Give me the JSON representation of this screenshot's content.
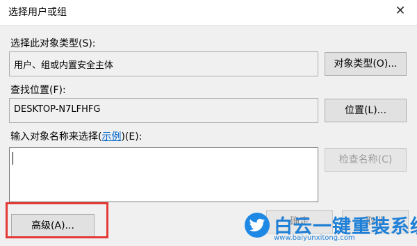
{
  "window": {
    "title": "选择用户或组"
  },
  "object_type": {
    "label": "选择此对象类型(S):",
    "value": "用户、组或内置安全主体",
    "button": "对象类型(O)..."
  },
  "location": {
    "label": "查找位置(F):",
    "value": "DESKTOP-N7LFHFG",
    "button": "位置(L)..."
  },
  "names": {
    "label_prefix": "输入对象名称来选择(",
    "label_link": "示例",
    "label_suffix": ")(E):",
    "value": "",
    "check_button": "检查名称(C)"
  },
  "footer": {
    "advanced_button": "高级(A)...",
    "ok_button": "确定",
    "cancel_button": "取消"
  },
  "watermark": {
    "brand": "白云一键重装系统",
    "url": "www.baiyunxitong.com"
  },
  "colors": {
    "highlight": "#e53935",
    "link": "#0066cc",
    "watermark": "#1e7fd6"
  }
}
